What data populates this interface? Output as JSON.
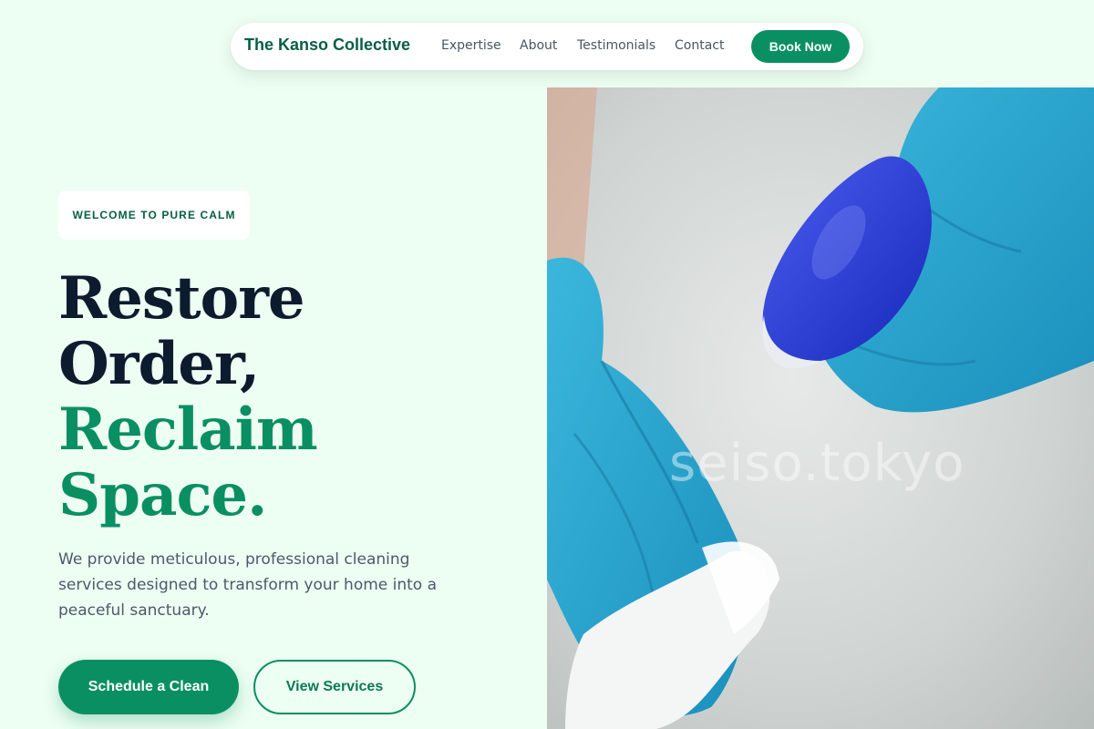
{
  "nav": {
    "brand": "The Kanso Collective",
    "links": [
      "Expertise",
      "About",
      "Testimonials",
      "Contact"
    ],
    "cta": "Book Now"
  },
  "hero": {
    "badge": "WELCOME TO PURE CALM",
    "headline": {
      "line1": "Restore",
      "line2": "Order,",
      "line3": "Reclaim",
      "line4": "Space."
    },
    "description": "We provide meticulous, professional cleaning services designed to transform your home into a peaceful sanctuary.",
    "primary_button": "Schedule a Clean",
    "secondary_button": "View Services"
  },
  "image": {
    "watermark": "seiso.tokyo"
  },
  "colors": {
    "background": "#edfef2",
    "brand_green": "#0a8f63",
    "dark_green": "#075e43",
    "headline_dark": "#0d1b2e",
    "body_text": "#4d5969"
  }
}
